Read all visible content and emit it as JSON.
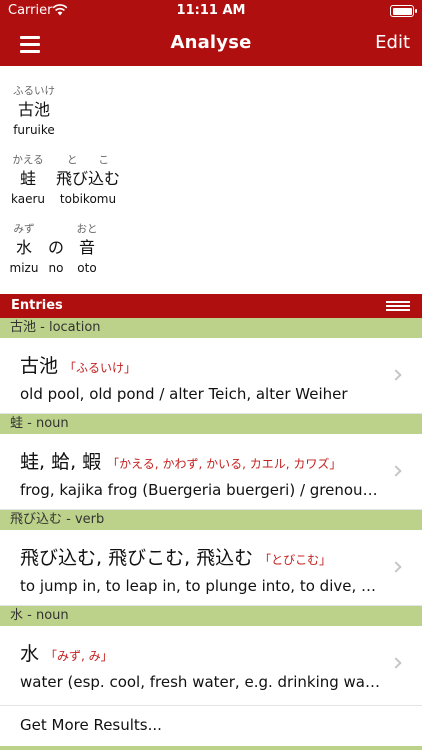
{
  "status_bar": {
    "carrier": "Carrier",
    "time": "11:11 AM"
  },
  "nav": {
    "title": "Analyse",
    "edit_label": "Edit"
  },
  "analysis": {
    "line1": [
      {
        "reading": "ふるいけ",
        "kanji": "古池",
        "romaji": "furuike"
      }
    ],
    "line2": [
      {
        "reading": "かえる",
        "kanji": "蛙",
        "romaji": "kaeru"
      },
      {
        "reading": "と　　こ",
        "kanji": "飛び込む",
        "romaji": "tobikomu"
      }
    ],
    "line3": [
      {
        "reading": "みず",
        "kanji": "水",
        "romaji": "mizu"
      },
      {
        "reading": "",
        "kanji": "の",
        "romaji": "no"
      },
      {
        "reading": "おと",
        "kanji": "音",
        "romaji": "oto"
      }
    ]
  },
  "entries": {
    "header": "Entries",
    "sections": [
      {
        "label": "古池 - location",
        "kanji": "古池",
        "kana": "「ふるいけ」",
        "gloss": "old pool, old pond / alter Teich, alter Weiher"
      },
      {
        "label": "蛙 - noun",
        "kanji": "蛙, 蛤, 蝦",
        "kana": "「かえる, かわず, かいる, カエル, カワズ」",
        "gloss": "frog, kajika frog (Buergeria buergeri) / grenouille"
      },
      {
        "label": "飛び込む - verb",
        "kanji": "飛び込む, 飛びこむ, 飛込む",
        "kana": "「とびこむ」",
        "gloss": "to jump in, to leap in, to plunge into, to dive, to rush in"
      },
      {
        "label": "水 - noun",
        "kanji": "水",
        "kana": "「みず, み」",
        "gloss": "water (esp. cool, fresh water, e.g. drinking water)"
      }
    ],
    "more_label": "Get More Results..."
  },
  "colors": {
    "brand_red": "#b00f0f",
    "section_green": "#bcd28a",
    "kana_red": "#c42020"
  }
}
